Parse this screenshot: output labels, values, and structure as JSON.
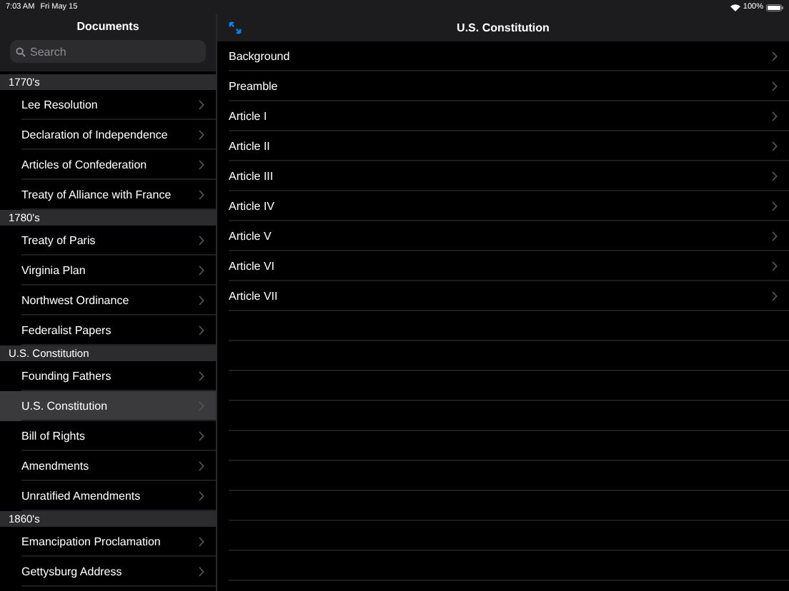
{
  "status_bar": {
    "time": "7:03 AM",
    "date": "Fri May 15",
    "battery": "100%"
  },
  "sidebar": {
    "title": "Documents",
    "search": {
      "placeholder": "Search"
    },
    "sections": [
      {
        "header": "1770's",
        "items": [
          {
            "label": "Lee Resolution",
            "selected": false
          },
          {
            "label": "Declaration of Independence",
            "selected": false
          },
          {
            "label": "Articles of Confederation",
            "selected": false
          },
          {
            "label": "Treaty of Alliance with France",
            "selected": false
          }
        ]
      },
      {
        "header": "1780's",
        "items": [
          {
            "label": "Treaty of Paris",
            "selected": false
          },
          {
            "label": "Virginia Plan",
            "selected": false
          },
          {
            "label": "Northwest Ordinance",
            "selected": false
          },
          {
            "label": "Federalist Papers",
            "selected": false
          }
        ]
      },
      {
        "header": "U.S. Constitution",
        "items": [
          {
            "label": "Founding Fathers",
            "selected": false
          },
          {
            "label": "U.S. Constitution",
            "selected": true
          },
          {
            "label": "Bill of Rights",
            "selected": false
          },
          {
            "label": "Amendments",
            "selected": false
          },
          {
            "label": "Unratified Amendments",
            "selected": false
          }
        ]
      },
      {
        "header": "1860's",
        "items": [
          {
            "label": "Emancipation Proclamation",
            "selected": false
          },
          {
            "label": "Gettysburg Address",
            "selected": false
          }
        ]
      }
    ]
  },
  "detail": {
    "title": "U.S. Constitution",
    "items": [
      "Background",
      "Preamble",
      "Article I",
      "Article II",
      "Article III",
      "Article IV",
      "Article V",
      "Article VI",
      "Article VII"
    ]
  }
}
